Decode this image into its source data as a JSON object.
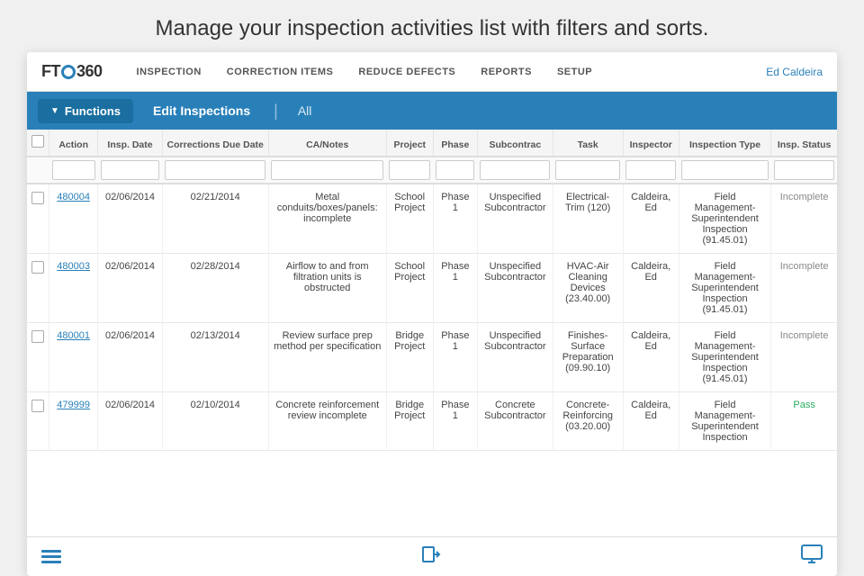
{
  "headline": "Manage your inspection activities list with filters and sorts.",
  "nav": {
    "logo": "FTQ",
    "logo_suffix": "360",
    "links": [
      "INSPECTION",
      "CORRECTION ITEMS",
      "REDUCE DEFECTS",
      "REPORTS",
      "SETUP"
    ],
    "user": "Ed Caldeira"
  },
  "toolbar": {
    "functions_label": "Functions",
    "edit_inspections_label": "Edit Inspections",
    "all_label": "All"
  },
  "table": {
    "columns": [
      "Action",
      "Insp. Date",
      "Corrections Due Date",
      "CA/Notes",
      "Project",
      "Phase",
      "Subcontrac",
      "Task",
      "Inspector",
      "Inspection Type",
      "Insp. Status"
    ],
    "rows": [
      {
        "id": "480004",
        "insp_date": "02/06/2014",
        "corrections_due": "02/21/2014",
        "notes": "Metal conduits/boxes/panels: incomplete",
        "project": "School Project",
        "phase": "Phase 1",
        "subcontrac": "Unspecified Subcontractor",
        "task": "Electrical-Trim (120)",
        "inspector": "Caldeira, Ed",
        "insp_type": "Field Management-Superintendent Inspection (91.45.01)",
        "status": "Incomplete",
        "status_class": "status-incomplete"
      },
      {
        "id": "480003",
        "insp_date": "02/06/2014",
        "corrections_due": "02/28/2014",
        "notes": "Airflow to and from filtration units is obstructed",
        "project": "School Project",
        "phase": "Phase 1",
        "subcontrac": "Unspecified Subcontractor",
        "task": "HVAC-Air Cleaning Devices (23.40.00)",
        "inspector": "Caldeira, Ed",
        "insp_type": "Field Management-Superintendent Inspection (91.45.01)",
        "status": "Incomplete",
        "status_class": "status-incomplete"
      },
      {
        "id": "480001",
        "insp_date": "02/06/2014",
        "corrections_due": "02/13/2014",
        "notes": "Review surface prep method per specification",
        "project": "Bridge Project",
        "phase": "Phase 1",
        "subcontrac": "Unspecified Subcontractor",
        "task": "Finishes-Surface Preparation (09.90.10)",
        "inspector": "Caldeira, Ed",
        "insp_type": "Field Management-Superintendent Inspection (91.45.01)",
        "status": "Incomplete",
        "status_class": "status-incomplete"
      },
      {
        "id": "479999",
        "insp_date": "02/06/2014",
        "corrections_due": "02/10/2014",
        "notes": "Concrete reinforcement review incomplete",
        "project": "Bridge Project",
        "phase": "Phase 1",
        "subcontrac": "Concrete Subcontractor",
        "task": "Concrete-Reinforcing (03.20.00)",
        "inspector": "Caldeira, Ed",
        "insp_type": "Field Management-Superintendent Inspection",
        "status": "Pass",
        "status_class": "status-pass"
      }
    ]
  },
  "bottom": {
    "menu_icon": "≡",
    "login_icon": "⬤",
    "monitor_icon": "⬤"
  }
}
